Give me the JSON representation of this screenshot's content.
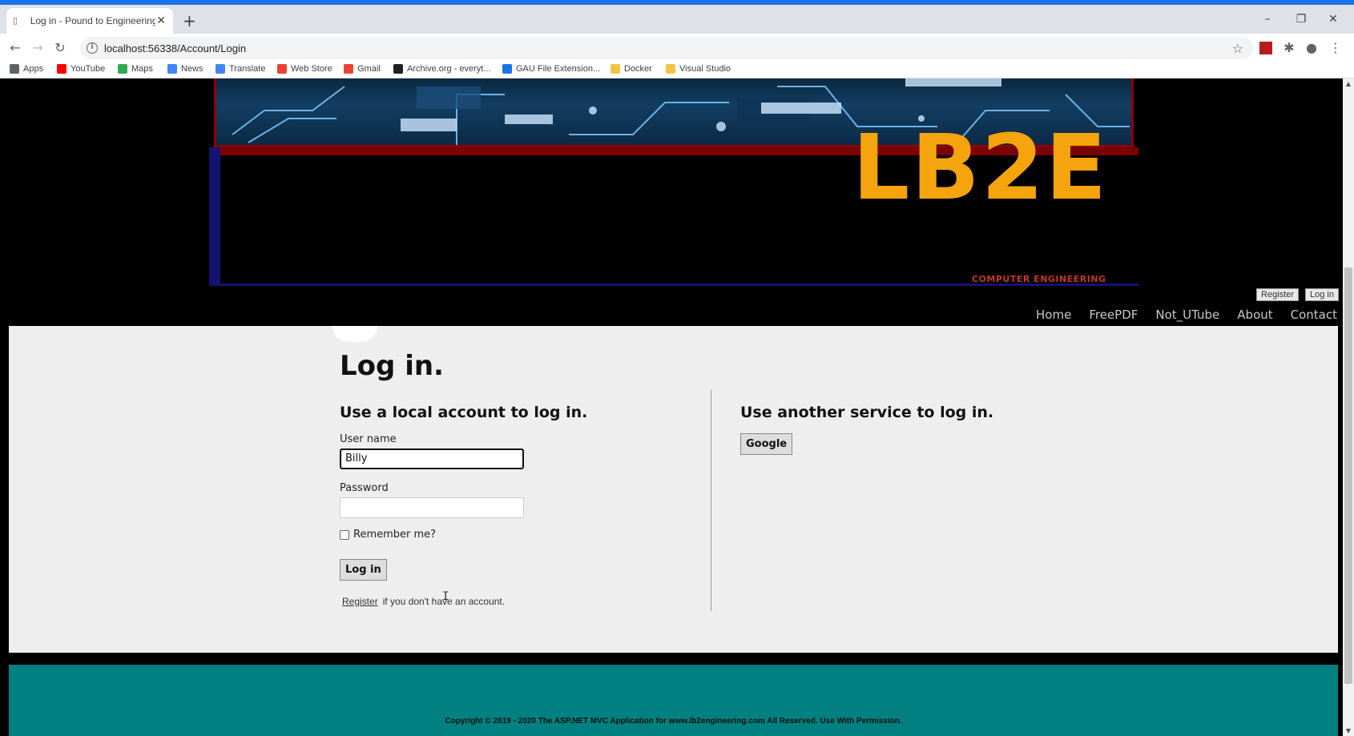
{
  "browser": {
    "tab_title": "Log in - Pound to Engineering.co",
    "url": "localhost:56338/Account/Login",
    "bookmarks": [
      {
        "label": "Apps",
        "color": "#5f6368"
      },
      {
        "label": "YouTube",
        "color": "#ff0000"
      },
      {
        "label": "Maps",
        "color": "#34a853"
      },
      {
        "label": "News",
        "color": "#4285f4"
      },
      {
        "label": "Translate",
        "color": "#4285f4"
      },
      {
        "label": "Web Store",
        "color": "#ea4335"
      },
      {
        "label": "Gmail",
        "color": "#ea4335"
      },
      {
        "label": "Archive.org - everyt...",
        "color": "#202124"
      },
      {
        "label": "GAU File Extension...",
        "color": "#1a73e8"
      },
      {
        "label": "Docker",
        "color": "#f4c542"
      },
      {
        "label": "Visual Studio",
        "color": "#f4c542"
      }
    ]
  },
  "banner": {
    "logo": "LB2E",
    "tagline": "COMPUTER ENGINEERING",
    "logo_color": "#f5a40d"
  },
  "account": {
    "register": "Register",
    "login": "Log in"
  },
  "nav": [
    "Home",
    "FreePDF",
    "Not_UTube",
    "About",
    "Contact"
  ],
  "login": {
    "title": "Log in.",
    "local_heading": "Use a local account to log in.",
    "username_label": "User name",
    "username_value": "Billy",
    "password_label": "Password",
    "password_value": "",
    "remember_label": "Remember me?",
    "submit": "Log in",
    "register_link": "Register",
    "register_suffix": "if you don't have an account.",
    "external_heading": "Use another service to log in.",
    "google_button": "Google"
  },
  "footer": {
    "text": "Copyright © 2019 - 2020 The ASP.NET MVC Application for www.lb2engineering.com All Reserved. Use With Permission.",
    "color": "#008080"
  }
}
